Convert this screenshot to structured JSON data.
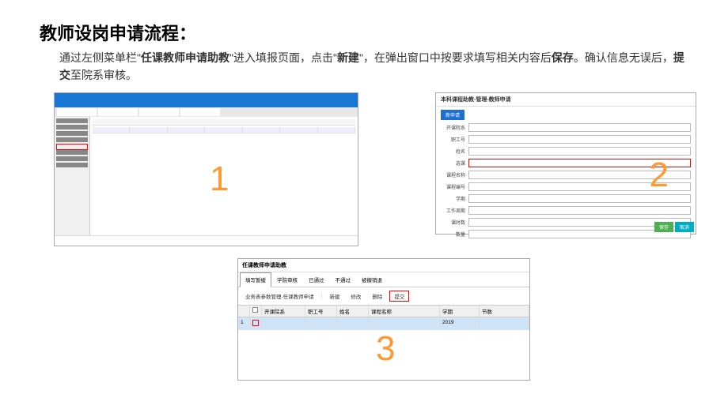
{
  "title": "教师设岗申请流程：",
  "description": {
    "p1a": "通过左侧菜单栏\"",
    "p1b": "任课教师申请助教",
    "p1c": "\"进入填报页面，点击\"",
    "p1d": "新建",
    "p1e": "\"，在弹出窗口中按要求填写相关内容后",
    "p1f": "保存",
    "p1g": "。确认信息无误后，",
    "p1h": "提交",
    "p1i": "至院系审核。"
  },
  "shot2": {
    "header": "本科课程助教-管理-教师申请",
    "newbtn": "新申请",
    "labels": [
      "开课院系",
      "职工号",
      "姓名",
      "选课",
      "课程名称",
      "课程编号",
      "学期",
      "工作周期",
      "课时数",
      "数量"
    ],
    "save": "保存",
    "cancel": "取消"
  },
  "shot3": {
    "title": "任课教师申请助教",
    "tabs": [
      "填写暂缓",
      "学院审核",
      "已通过",
      "不通过",
      "被撤销退"
    ],
    "actions_left": "业务表参数管理-任课教师申请",
    "actions": [
      "新建",
      "修改",
      "删除",
      "提交"
    ],
    "columns": [
      "",
      "",
      "开课院系",
      "职工号",
      "姓名",
      "课程名称",
      "学期",
      "节数"
    ],
    "row": [
      "1",
      "",
      "",
      "",
      "",
      "",
      "2019",
      ""
    ]
  },
  "nums": {
    "n1": "1",
    "n2": "2",
    "n3": "3"
  }
}
